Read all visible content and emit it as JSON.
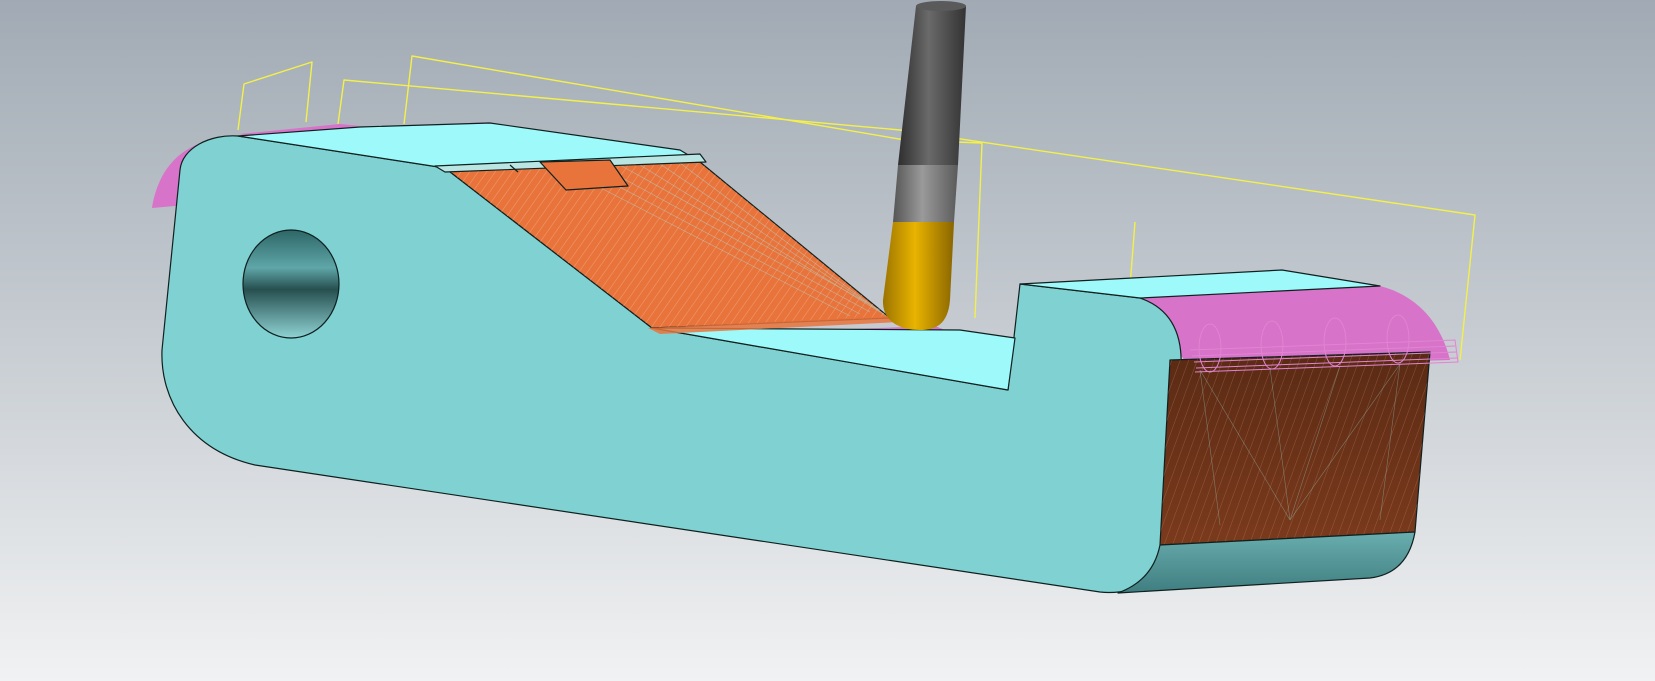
{
  "viewport": {
    "background_top": "#a1aab4",
    "background_bottom": "#f1f2f3"
  },
  "part": {
    "side_face_color": "#7fd1d2",
    "top_face_color": "#9ef9fa",
    "bore_color": "#3f8a8c",
    "edge_color": "#10201f"
  },
  "machined_surfaces": {
    "ramp_color": "#e8743c",
    "pocket_wall_color": "#7a3a1c",
    "offset_color": "#d773c9"
  },
  "toolpath": {
    "rapid_color": "#f4f04a",
    "linking_color": "#e184d2",
    "cut_pattern_color": "#9ee6e4"
  },
  "tool": {
    "holder_color": "#4b4b4b",
    "shank_color": "#777777",
    "cutter_color": "#d6a300",
    "cutter_type": "ball-nose"
  }
}
